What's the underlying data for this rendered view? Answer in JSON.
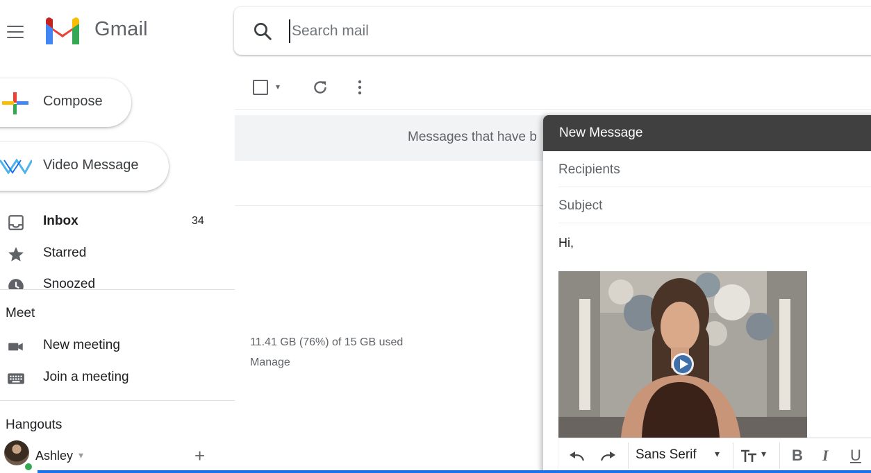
{
  "app": {
    "title": "Gmail"
  },
  "search": {
    "placeholder": "Search mail"
  },
  "sidebar": {
    "compose_label": "Compose",
    "video_message_label": "Video Message",
    "items": [
      {
        "label": "Inbox",
        "count": "34",
        "icon": "inbox-icon"
      },
      {
        "label": "Starred",
        "icon": "star-icon"
      },
      {
        "label": "Snoozed",
        "icon": "clock-icon"
      }
    ]
  },
  "meet": {
    "title": "Meet",
    "items": [
      {
        "label": "New meeting",
        "icon": "video-camera-icon"
      },
      {
        "label": "Join a meeting",
        "icon": "keyboard-icon"
      }
    ]
  },
  "hangouts": {
    "title": "Hangouts",
    "user_name": "Ashley",
    "caret": "▾",
    "add_symbol": "+"
  },
  "toolbar": {
    "select_caret": "▾"
  },
  "main": {
    "banner_text": "Messages that have b",
    "storage_text": "11.41 GB (76%) of 15 GB used",
    "manage_label": "Manage"
  },
  "compose": {
    "header_title": "New Message",
    "recipients_placeholder": "Recipients",
    "subject_placeholder": "Subject",
    "body_text": "Hi,",
    "font_name": "Sans Serif",
    "font_caret": "▾",
    "size_caret": "▾",
    "bold_label": "B",
    "italic_label": "I",
    "underline_label": "U"
  },
  "colors": {
    "accent": "#1a73e8",
    "compose_header": "#404040",
    "banner_bg": "#f1f3f4",
    "online_status": "#34a853"
  }
}
